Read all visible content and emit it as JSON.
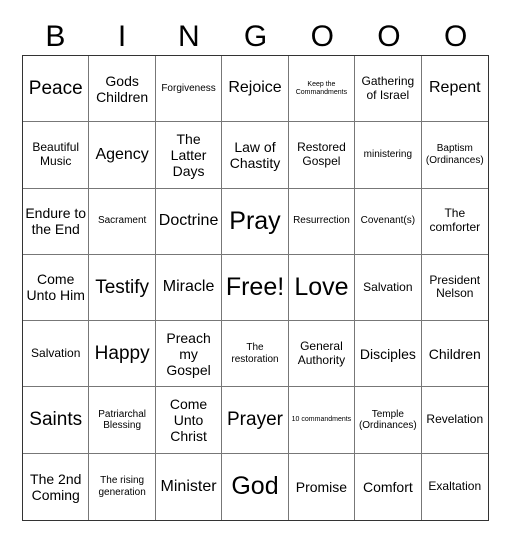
{
  "header": [
    "B",
    "I",
    "N",
    "G",
    "O",
    "O",
    "O"
  ],
  "cells": [
    {
      "text": "Peace",
      "size": "xxl"
    },
    {
      "text": "Gods Children",
      "size": "l"
    },
    {
      "text": "Forgiveness",
      "size": "s"
    },
    {
      "text": "Rejoice",
      "size": "xl"
    },
    {
      "text": "Keep the Commandments",
      "size": "xs"
    },
    {
      "text": "Gathering of Israel",
      "size": "m"
    },
    {
      "text": "Repent",
      "size": "xl"
    },
    {
      "text": "Beautiful Music",
      "size": "m"
    },
    {
      "text": "Agency",
      "size": "xl"
    },
    {
      "text": "The Latter Days",
      "size": "l"
    },
    {
      "text": "Law of Chastity",
      "size": "l"
    },
    {
      "text": "Restored Gospel",
      "size": "m"
    },
    {
      "text": "ministering",
      "size": "s"
    },
    {
      "text": "Baptism (Ordinances)",
      "size": "s"
    },
    {
      "text": "Endure to the End",
      "size": "l"
    },
    {
      "text": "Sacrament",
      "size": "s"
    },
    {
      "text": "Doctrine",
      "size": "xl"
    },
    {
      "text": "Pray",
      "size": "huge"
    },
    {
      "text": "Resurrection",
      "size": "s"
    },
    {
      "text": "Covenant(s)",
      "size": "s"
    },
    {
      "text": "The comforter",
      "size": "m"
    },
    {
      "text": "Come Unto Him",
      "size": "l"
    },
    {
      "text": "Testify",
      "size": "xxl"
    },
    {
      "text": "Miracle",
      "size": "xl"
    },
    {
      "text": "Free!",
      "size": "huge"
    },
    {
      "text": "Love",
      "size": "huge"
    },
    {
      "text": "Salvation",
      "size": "m"
    },
    {
      "text": "President Nelson",
      "size": "m"
    },
    {
      "text": "Salvation",
      "size": "m"
    },
    {
      "text": "Happy",
      "size": "xxl"
    },
    {
      "text": "Preach my Gospel",
      "size": "l"
    },
    {
      "text": "The restoration",
      "size": "s"
    },
    {
      "text": "General Authority",
      "size": "m"
    },
    {
      "text": "Disciples",
      "size": "l"
    },
    {
      "text": "Children",
      "size": "l"
    },
    {
      "text": "Saints",
      "size": "xxl"
    },
    {
      "text": "Patriarchal Blessing",
      "size": "s"
    },
    {
      "text": "Come Unto Christ",
      "size": "l"
    },
    {
      "text": "Prayer",
      "size": "xxl"
    },
    {
      "text": "10 commandments",
      "size": "xs"
    },
    {
      "text": "Temple (Ordinances)",
      "size": "s"
    },
    {
      "text": "Revelation",
      "size": "m"
    },
    {
      "text": "The 2nd Coming",
      "size": "l"
    },
    {
      "text": "The rising generation",
      "size": "s"
    },
    {
      "text": "Minister",
      "size": "xl"
    },
    {
      "text": "God",
      "size": "huge"
    },
    {
      "text": "Promise",
      "size": "l"
    },
    {
      "text": "Comfort",
      "size": "l"
    },
    {
      "text": "Exaltation",
      "size": "m"
    }
  ]
}
